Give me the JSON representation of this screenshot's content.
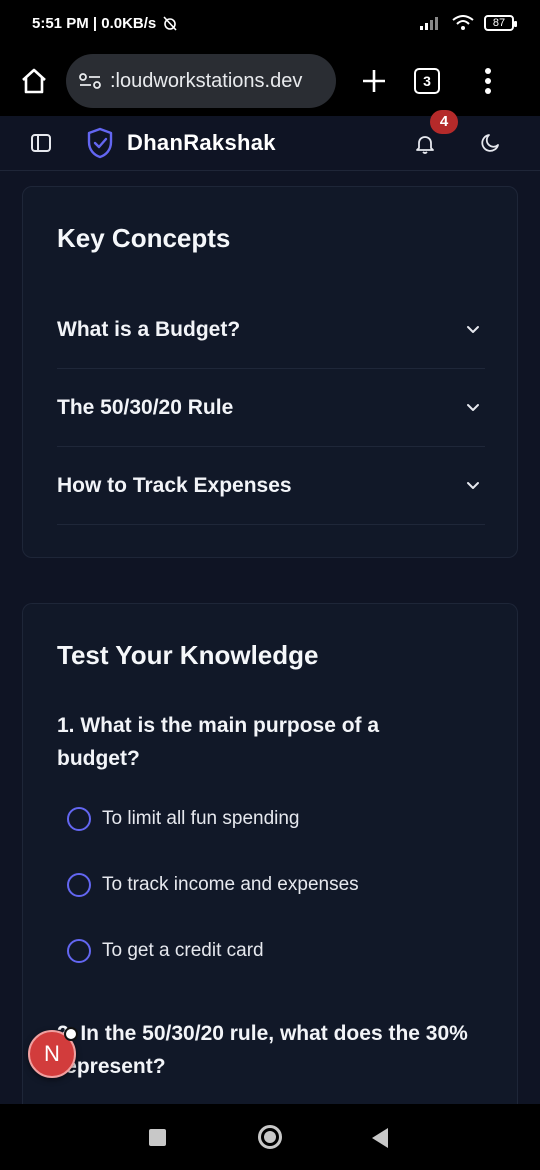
{
  "status_bar": {
    "time_speed": "5:51 PM | 0.0KB/s",
    "battery": "87"
  },
  "browser": {
    "url": ":loudworkstations.dev",
    "tab_count": "3"
  },
  "app": {
    "brand": "DhanRakshak",
    "notification_count": "4"
  },
  "key_concepts": {
    "title": "Key Concepts",
    "items": [
      {
        "label": "What is a Budget?"
      },
      {
        "label": "The 50/30/20 Rule"
      },
      {
        "label": "How to Track Expenses"
      }
    ]
  },
  "quiz": {
    "title": "Test Your Knowledge",
    "questions": [
      {
        "text": "1. What is the main purpose of a budget?",
        "options": [
          "To limit all fun spending",
          "To track income and expenses",
          "To get a credit card"
        ]
      },
      {
        "text": "2. In the 50/30/20 rule, what does the 30% represent?"
      }
    ]
  },
  "floating_avatar": {
    "letter": "N"
  },
  "colors": {
    "background": "#0f1424",
    "card": "#111828",
    "accent": "#6366f1",
    "badge": "#b42a2a"
  }
}
